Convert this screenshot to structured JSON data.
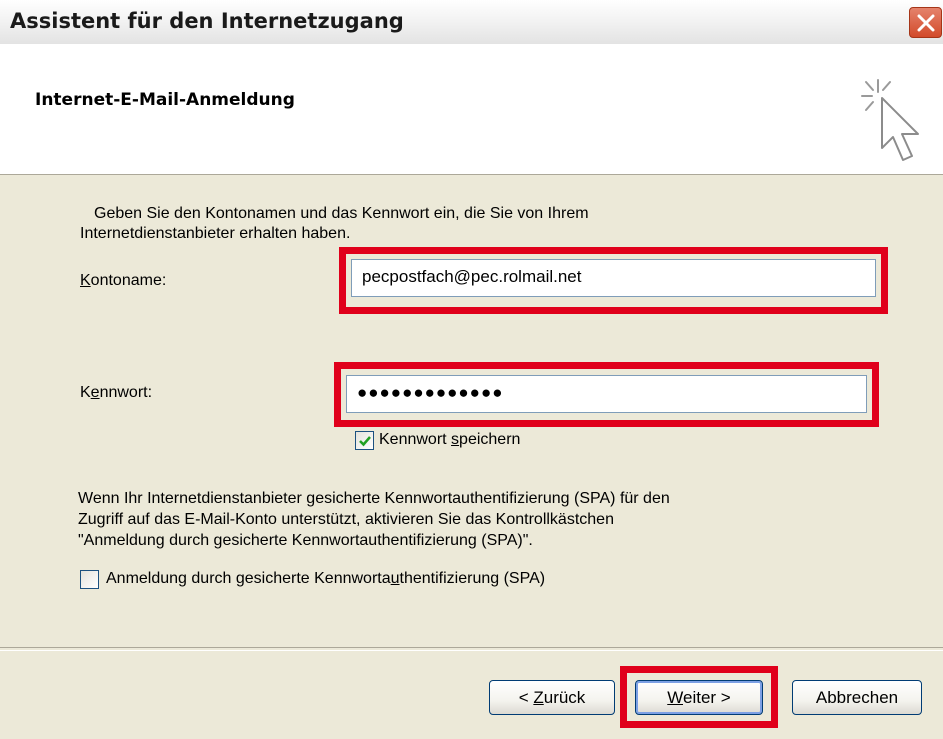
{
  "window": {
    "title": "Assistent für den Internetzugang"
  },
  "header": {
    "title": "Internet-E-Mail-Anmeldung",
    "icon": "wizard-cursor-sparkle-icon"
  },
  "intro": {
    "line1": "Geben Sie den Kontonamen und das Kennwort ein, die Sie von Ihrem",
    "line2": "Internetdienstanbieter erhalten haben."
  },
  "account": {
    "label_pre": "",
    "label_access_key": "K",
    "label_post": "ontoname:",
    "value": "pecpostfach@pec.rolmail.net"
  },
  "password": {
    "label_pre": "K",
    "label_access_key": "e",
    "label_post": "nnwort:",
    "value_masked": "●●●●●●●●●●●●●"
  },
  "save_password": {
    "checked": true,
    "label_pre": "Kennwort ",
    "label_access_key": "s",
    "label_post": "peichern"
  },
  "spa_info": {
    "line1": "Wenn Ihr Internetdienstanbieter gesicherte Kennwortauthentifizierung (SPA) für den",
    "line2": "Zugriff auf das E-Mail-Konto unterstützt, aktivieren Sie das Kontrollkästchen",
    "line3": "\"Anmeldung durch gesicherte Kennwortauthentifizierung (SPA)\"."
  },
  "spa_checkbox": {
    "checked": false,
    "label_pre": "Anmeldung durch gesicherte Kennworta",
    "label_access_key": "u",
    "label_post": "thentifizierung (SPA)"
  },
  "buttons": {
    "back_pre": "< ",
    "back_access_key": "Z",
    "back_post": "urück",
    "next_pre": "",
    "next_access_key": "W",
    "next_post": "eiter >",
    "cancel": "Abbrechen"
  },
  "colors": {
    "highlight": "#e0001b",
    "dialog_bg": "#ece9d8",
    "field_border": "#7f9db9"
  }
}
